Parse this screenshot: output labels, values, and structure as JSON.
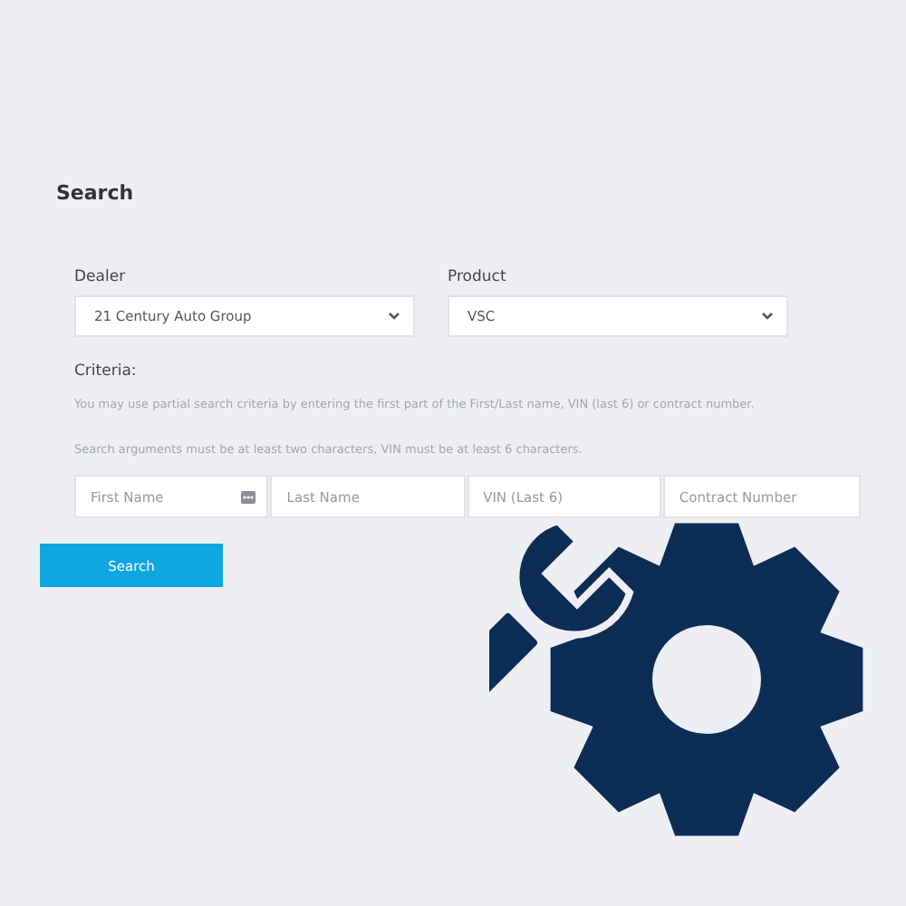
{
  "heading": "Search",
  "selects": [
    {
      "label": "Dealer",
      "value": "21 Century Auto Group"
    },
    {
      "label": "Product",
      "value": "VSC"
    }
  ],
  "criteria": {
    "label": "Criteria:",
    "notes": [
      "You may use partial search criteria by entering the first part of the First/Last name, VIN (last 6) or contract number.",
      "Search arguments must be at least two characters, VIN must be at least 6 characters."
    ]
  },
  "fields": [
    {
      "placeholder": "First Name",
      "kind": "autofill"
    },
    {
      "placeholder": "Last Name",
      "kind": "plain"
    },
    {
      "placeholder": "VIN (Last 6)",
      "kind": "plain"
    },
    {
      "placeholder": "Contract Number",
      "kind": "plain"
    }
  ],
  "button": "Search"
}
